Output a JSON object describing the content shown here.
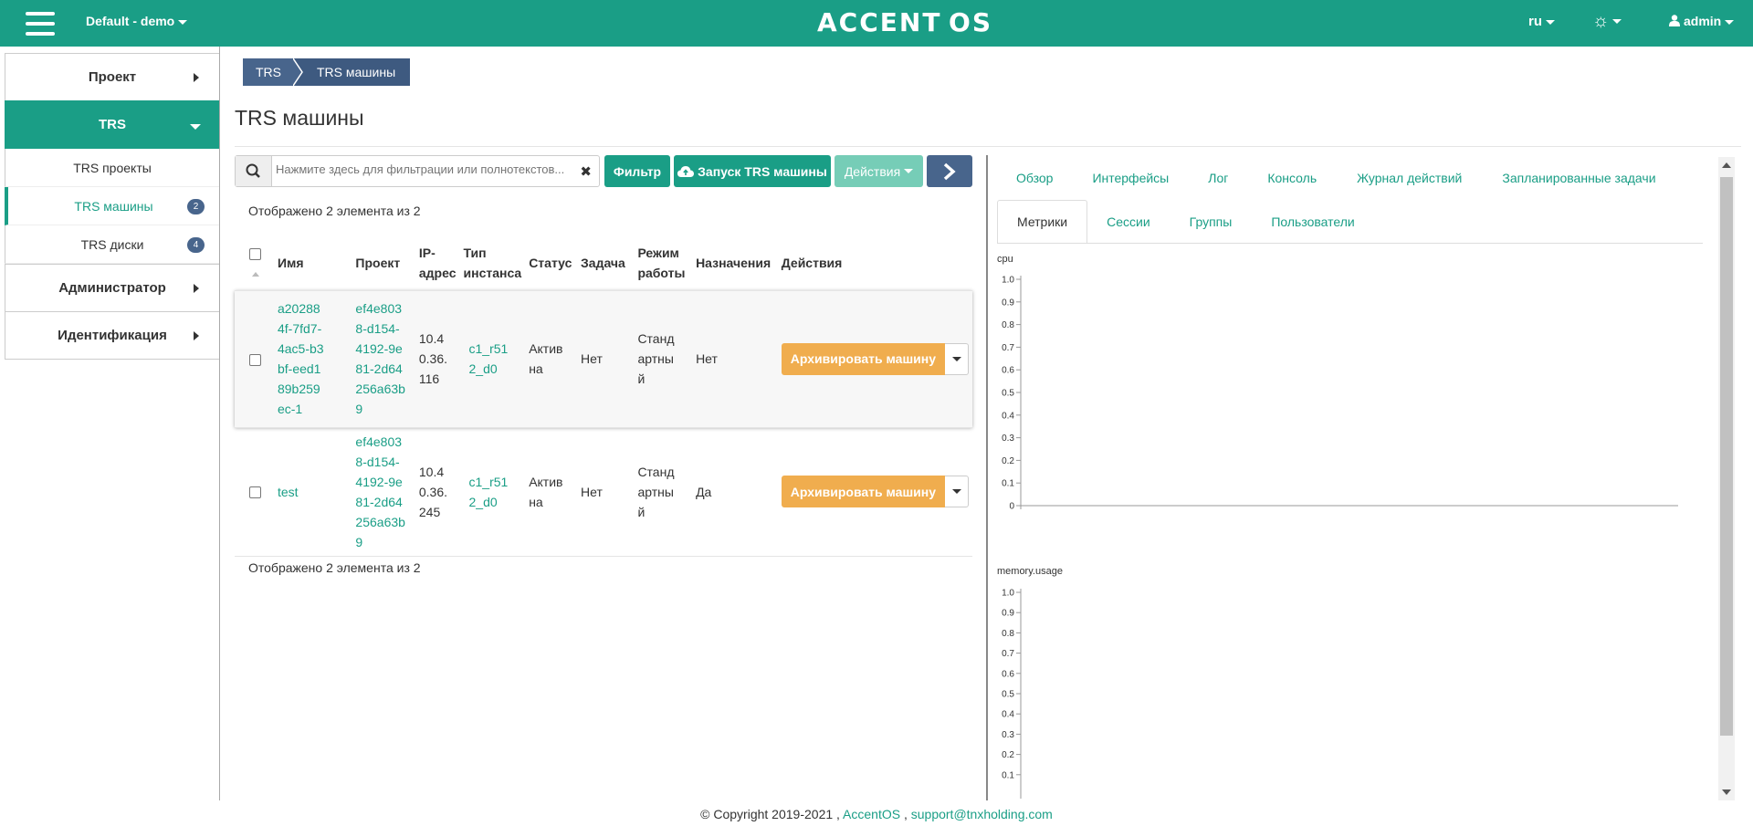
{
  "header": {
    "project": "Default - demo",
    "logo": "ACCENT OS",
    "lang": "ru",
    "user": "admin"
  },
  "sidebar": {
    "groups": [
      {
        "label": "Проект"
      },
      {
        "label": "TRS"
      },
      {
        "label": "Администратор"
      },
      {
        "label": "Идентификация"
      }
    ],
    "items": [
      {
        "label": "TRS проекты"
      },
      {
        "label": "TRS машины",
        "badge": "2"
      },
      {
        "label": "TRS диски",
        "badge": "4"
      }
    ]
  },
  "breadcrumb": {
    "root": "TRS",
    "current": "TRS машины"
  },
  "page": {
    "title": "TRS машины"
  },
  "toolbar": {
    "search_placeholder": "Нажмите здесь для фильтрации или полнотекстов...",
    "filter": "Фильтр",
    "launch": "Запуск TRS машины",
    "actions": "Действия"
  },
  "table": {
    "count_top": "Отображено 2 элемента из 2",
    "count_bottom": "Отображено 2 элемента из 2",
    "columns": [
      "Имя",
      "Проект",
      "IP-адрес",
      "Тип инстанса",
      "Статус",
      "Задача",
      "Режим работы",
      "Назначения",
      "Действия"
    ],
    "rows": [
      {
        "name": "a202884f-7fd7-4ac5-b3bf-eed189b259ec-1",
        "project": "ef4e8038-d154-4192-9e81-2d64256a63b9",
        "ip": "10.40.36.116",
        "type": "c1_r512_d0",
        "status": "Активна",
        "task": "Нет",
        "mode": "Стандартный",
        "assign": "Нет",
        "action": "Архивировать машину"
      },
      {
        "name": "test",
        "project": "ef4e8038-d154-4192-9e81-2d64256a63b9",
        "ip": "10.40.36.245",
        "type": "c1_r512_d0",
        "status": "Активна",
        "task": "Нет",
        "mode": "Стандартный",
        "assign": "Да",
        "action": "Архивировать машину"
      }
    ]
  },
  "detail": {
    "tabs_row1": [
      "Обзор",
      "Интерфейсы",
      "Лог",
      "Консоль",
      "Журнал действий",
      "Запланированные задачи"
    ],
    "tabs_row2": [
      "Метрики",
      "Сессии",
      "Группы",
      "Пользователи"
    ]
  },
  "chart_data": [
    {
      "type": "line",
      "title": "cpu",
      "ylim": [
        0,
        1.0
      ],
      "yticks": [
        "1.0",
        "0.9",
        "0.8",
        "0.7",
        "0.6",
        "0.5",
        "0.4",
        "0.3",
        "0.2",
        "0.1",
        "0"
      ],
      "series": []
    },
    {
      "type": "line",
      "title": "memory.usage",
      "ylim": [
        0,
        1.0
      ],
      "yticks": [
        "1.0",
        "0.9",
        "0.8",
        "0.7",
        "0.6",
        "0.5",
        "0.4",
        "0.3",
        "0.2",
        "0.1"
      ],
      "series": []
    }
  ],
  "footer": {
    "copyright": "© Copyright 2019-2021 ,",
    "brand": "AccentOS",
    "sep": ",",
    "email": "support@tnxholding.com"
  }
}
